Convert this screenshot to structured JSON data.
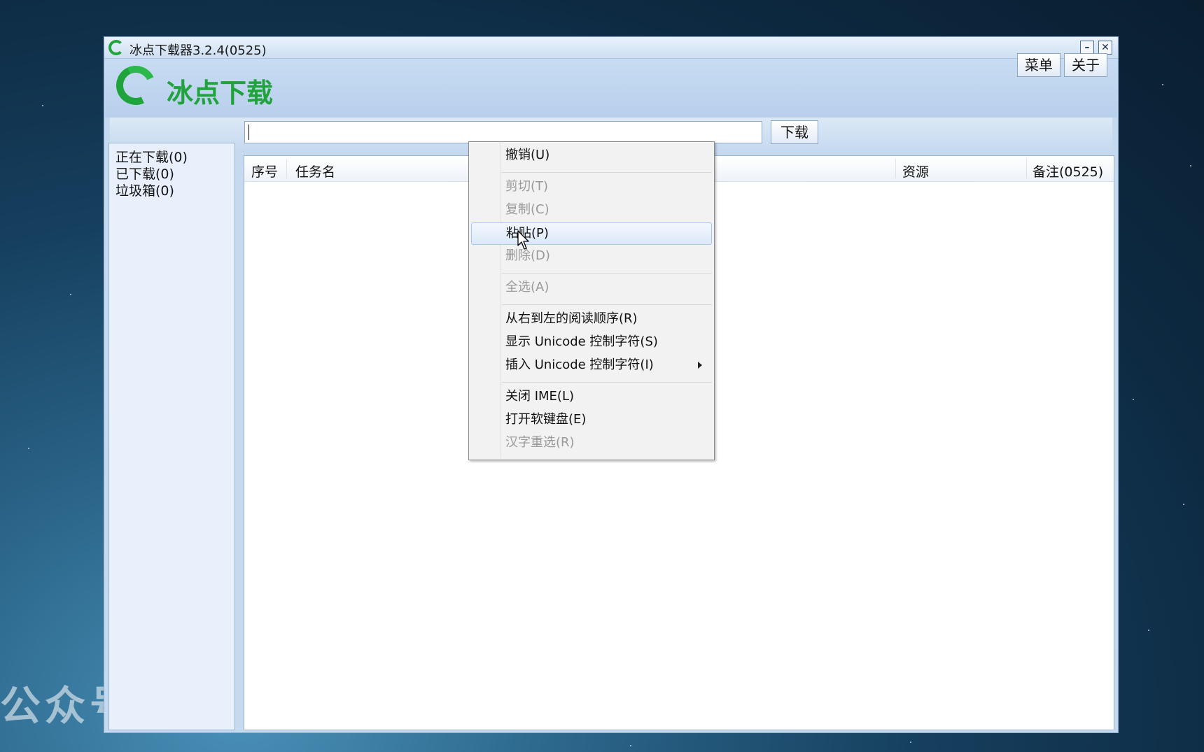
{
  "watermark": "公众号：云标",
  "window": {
    "title": "冰点下载器3.2.4(0525)",
    "minimize_glyph": "–",
    "close_glyph": "✕"
  },
  "header": {
    "brand": "冰点下载",
    "menu_button": "菜单",
    "about_button": "关于"
  },
  "toolbar": {
    "url_value": "",
    "download_button": "下载"
  },
  "sidebar": {
    "items": [
      {
        "label": "正在下载(0)"
      },
      {
        "label": "已下载(0)"
      },
      {
        "label": "垃圾箱(0)"
      }
    ]
  },
  "list": {
    "columns": [
      "序号",
      "任务名",
      "资源",
      "备注(0525)"
    ]
  },
  "context_menu": {
    "items": [
      {
        "label": "撤销(U)",
        "enabled": true
      },
      {
        "label": "剪切(T)",
        "enabled": false
      },
      {
        "label": "复制(C)",
        "enabled": false
      },
      {
        "label": "粘贴(P)",
        "enabled": true,
        "hovered": true
      },
      {
        "label": "删除(D)",
        "enabled": false
      },
      {
        "label": "全选(A)",
        "enabled": false
      },
      {
        "label": "从右到左的阅读顺序(R)",
        "enabled": true
      },
      {
        "label": "显示 Unicode 控制字符(S)",
        "enabled": true
      },
      {
        "label": "插入 Unicode 控制字符(I)",
        "enabled": true,
        "submenu": true
      },
      {
        "label": "关闭 IME(L)",
        "enabled": true
      },
      {
        "label": "打开软键盘(E)",
        "enabled": true
      },
      {
        "label": "汉字重选(R)",
        "enabled": false
      }
    ]
  },
  "colors": {
    "brand_green": "#20a23c",
    "window_blue": "#c5d9ef"
  }
}
